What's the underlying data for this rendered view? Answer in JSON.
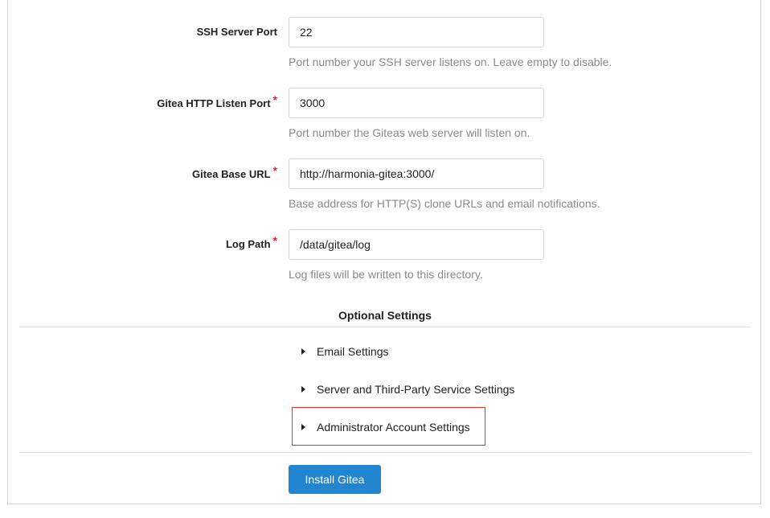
{
  "fields": [
    {
      "label": "SSH Server Port",
      "required": false,
      "value": "22",
      "help": "Port number your SSH server listens on. Leave empty to disable."
    },
    {
      "label": "Gitea HTTP Listen Port",
      "required": true,
      "value": "3000",
      "help": "Port number the Giteas web server will listen on."
    },
    {
      "label": "Gitea Base URL",
      "required": true,
      "value": "http://harmonia-gitea:3000/",
      "help": "Base address for HTTP(S) clone URLs and email notifications."
    },
    {
      "label": "Log Path",
      "required": true,
      "value": "/data/gitea/log",
      "help": "Log files will be written to this directory."
    }
  ],
  "required_marker": "*",
  "optional": {
    "title": "Optional Settings",
    "sections": [
      {
        "label": "Email Settings"
      },
      {
        "label": "Server and Third-Party Service Settings"
      },
      {
        "label": "Administrator Account Settings"
      }
    ]
  },
  "install_button": "Install Gitea",
  "colors": {
    "primary": "#2185d0",
    "required": "#db2828",
    "highlight": "#e0311f",
    "help_text": "#8a8a8a"
  }
}
